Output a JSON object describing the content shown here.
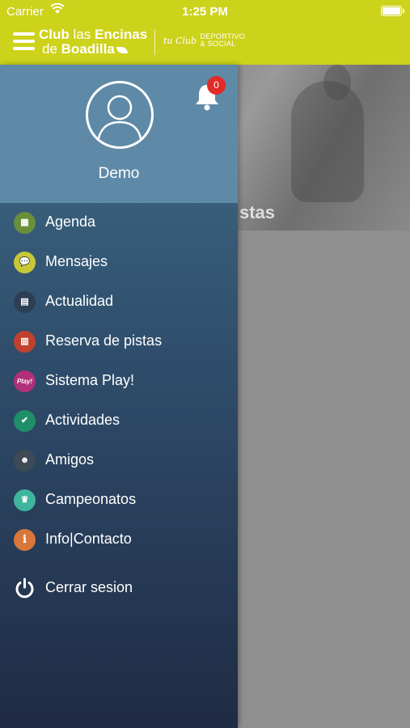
{
  "status_bar": {
    "carrier": "Carrier",
    "time": "1:25 PM"
  },
  "header": {
    "logo_line1_bold": "Club",
    "logo_line1_light": "las",
    "logo_line1_bold2": "Encinas",
    "logo_line2_light": "de",
    "logo_line2_bold": "Boadilla",
    "tagline_script": "tu Club",
    "tagline_line1": "DEPORTIVO",
    "tagline_line2": "& SOCIAL"
  },
  "background": {
    "hero_title_fragment": "stas"
  },
  "drawer": {
    "user_name": "Demo",
    "notification_count": "0",
    "items": [
      {
        "label": "Agenda",
        "icon": "calendar-icon",
        "color": "#6a8f3a",
        "glyph": "▦"
      },
      {
        "label": "Mensajes",
        "icon": "chat-icon",
        "color": "#c6c935",
        "glyph": "💬"
      },
      {
        "label": "Actualidad",
        "icon": "news-icon",
        "color": "#2d3f55",
        "glyph": "▤"
      },
      {
        "label": "Reserva de pistas",
        "icon": "court-icon",
        "color": "#c0412e",
        "glyph": "▥"
      },
      {
        "label": "Sistema Play!",
        "icon": "play-icon",
        "color": "#b0307a",
        "glyph": "Play!"
      },
      {
        "label": "Actividades",
        "icon": "heart-check-icon",
        "color": "#1f8f6a",
        "glyph": "✔"
      },
      {
        "label": "Amigos",
        "icon": "friends-icon",
        "color": "#3e4a55",
        "glyph": "☻"
      },
      {
        "label": "Campeonatos",
        "icon": "trophy-icon",
        "color": "#3fb59e",
        "glyph": "♛"
      },
      {
        "label": "Info|Contacto",
        "icon": "info-icon",
        "color": "#d9773a",
        "glyph": "i"
      }
    ],
    "logout_label": "Cerrar sesion"
  }
}
